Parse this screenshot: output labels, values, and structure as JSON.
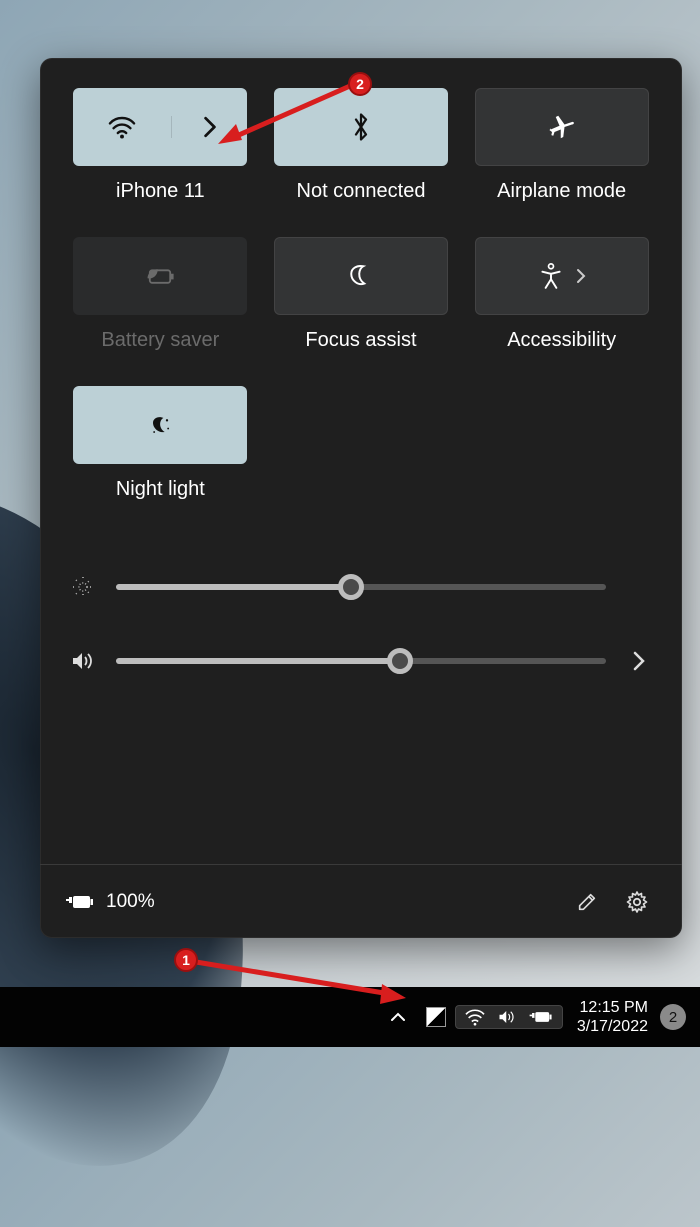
{
  "tiles": [
    {
      "label": "iPhone 11",
      "icon": "wifi",
      "state": "on",
      "split": true
    },
    {
      "label": "Not connected",
      "icon": "bluetooth",
      "state": "on",
      "split": false
    },
    {
      "label": "Airplane mode",
      "icon": "airplane",
      "state": "off",
      "split": false
    },
    {
      "label": "Battery saver",
      "icon": "battery-leaf",
      "state": "disabled",
      "split": false
    },
    {
      "label": "Focus assist",
      "icon": "moon",
      "state": "off",
      "split": false
    },
    {
      "label": "Accessibility",
      "icon": "accessibility",
      "state": "off",
      "split": false,
      "chevron": true
    },
    {
      "label": "Night light",
      "icon": "night",
      "state": "on",
      "split": false
    }
  ],
  "sliders": {
    "brightness_pct": 48,
    "volume_pct": 58
  },
  "footer": {
    "battery_text": "100%"
  },
  "taskbar": {
    "time": "12:15 PM",
    "date": "3/17/2022",
    "notif_count": "2"
  },
  "annotations": {
    "badge1": "1",
    "badge2": "2"
  }
}
